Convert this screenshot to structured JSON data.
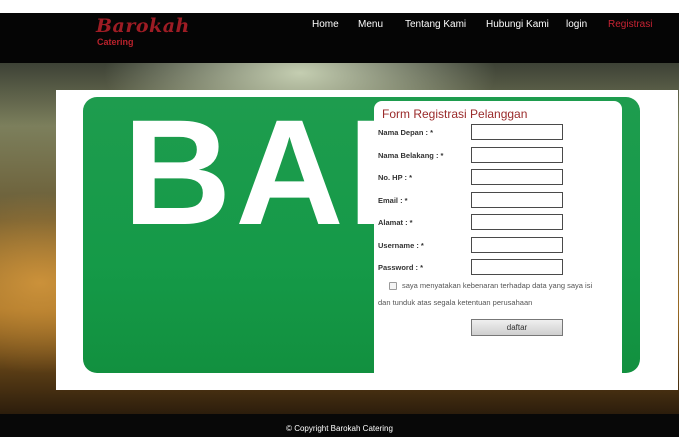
{
  "brand": {
    "name": "Barokah",
    "tagline": "Catering"
  },
  "nav": [
    {
      "label": "Home"
    },
    {
      "label": "Menu"
    },
    {
      "label": "Tentang Kami"
    },
    {
      "label": "Hubungi Kami"
    },
    {
      "label": "login"
    },
    {
      "label": "Registrasi",
      "active": true
    }
  ],
  "banner": {
    "text": "BAR"
  },
  "form": {
    "title": "Form Registrasi Pelanggan",
    "fields": [
      {
        "label": "Nama Depan : *",
        "value": ""
      },
      {
        "label": "Nama Belakang : *",
        "value": ""
      },
      {
        "label": "No. HP : *",
        "value": ""
      },
      {
        "label": "Email : *",
        "value": ""
      },
      {
        "label": "Alamat : *",
        "value": ""
      },
      {
        "label": "Username : *",
        "value": ""
      },
      {
        "label": "Password : *",
        "value": ""
      }
    ],
    "agree_line1": "saya menyatakan kebenaran terhadap data yang saya isi",
    "agree_line2": "dan tunduk atas segala ketentuan perusahaan",
    "agree_checked": false,
    "submit_label": "daftar"
  },
  "footer": {
    "copyright": "© Copyright Barokah Catering"
  },
  "colors": {
    "brand_red": "#9e1c24",
    "active_nav": "#c82333",
    "banner_green": "#159a48"
  }
}
